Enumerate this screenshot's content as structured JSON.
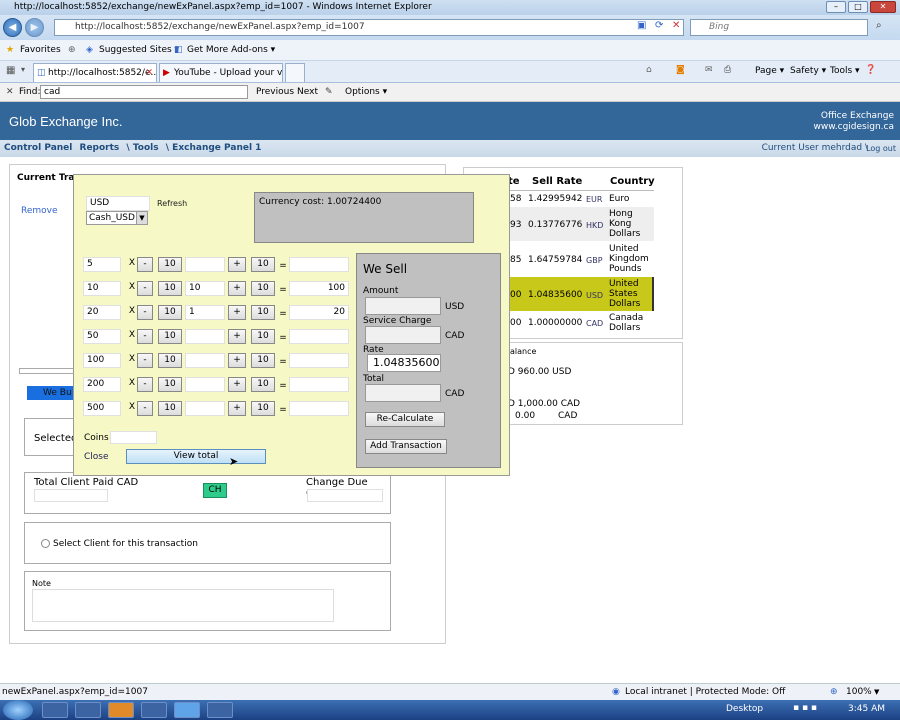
{
  "browser": {
    "window_title": "http://localhost:5852/exchange/newExPanel.aspx?emp_id=1007 - Windows Internet Explorer",
    "address": "http://localhost:5852/exchange/newExPanel.aspx?emp_id=1007",
    "search_placeholder": "Bing",
    "favorites": "Favorites",
    "suggested_sites": "Suggested Sites ▾",
    "addons": "Get More Add-ons ▾",
    "tabs": [
      "http://localhost:5852/e...",
      "YouTube - Upload your vi..."
    ],
    "page_menu": "Page ▾",
    "safety_menu": "Safety ▾",
    "tools_menu": "Tools ▾",
    "find_label": "Find:",
    "find_value": "cad",
    "previous": "Previous",
    "next": "Next",
    "options": "Options ▾"
  },
  "header": {
    "title": "Glob Exchange Inc.",
    "office": "Office Exchange",
    "site": "www.cgidesign.ca"
  },
  "menu": {
    "items": [
      "Control Panel",
      "Reports",
      "\\ Tools",
      "\\ Exchange Panel 1"
    ],
    "current_user": "Current User mehrdad \\",
    "logout": "Log out"
  },
  "left_panel": {
    "current_trans": "Current Tran",
    "remove": "Remove",
    "we_buy": "We Bu",
    "selected": "Selected",
    "total_client_paid": "Total Client Paid CAD",
    "ch": "CH",
    "change_due": "Change Due CAD",
    "select_client": "Select Client for this transaction",
    "note": "Note"
  },
  "rates": {
    "headers": [
      "te",
      "Sell Rate",
      "Country"
    ],
    "rows": [
      {
        "buy": "58",
        "sell": "1.42995942",
        "code": "EUR",
        "country": "Euro"
      },
      {
        "buy": "93",
        "sell": "0.13776776",
        "code": "HKD",
        "country": "Hong Kong Dollars"
      },
      {
        "buy": "85",
        "sell": "1.64759784",
        "code": "GBP",
        "country": "United Kingdom Pounds"
      },
      {
        "buy": "00",
        "sell": "1.04835600",
        "code": "USD",
        "country": "United States Dollars"
      },
      {
        "buy": "00",
        "sell": "1.00000000",
        "code": "CAD",
        "country": "Canada Dollars"
      }
    ],
    "balance_label": "alance",
    "balance_usd": "D 960.00 USD",
    "balance_cad1": "D 1,000.00 CAD",
    "balance_cad2_amount": "0.00",
    "balance_cad2_unit": "CAD"
  },
  "modal": {
    "currency": "USD",
    "refresh": "Refresh",
    "account": "Cash_USD",
    "currency_cost": "Currency cost: 1.00724400",
    "denominations": [
      {
        "face": "5",
        "qty": "",
        "total": ""
      },
      {
        "face": "10",
        "qty": "10",
        "total": "100"
      },
      {
        "face": "20",
        "qty": "1",
        "total": "20"
      },
      {
        "face": "50",
        "qty": "",
        "total": ""
      },
      {
        "face": "100",
        "qty": "",
        "total": ""
      },
      {
        "face": "200",
        "qty": "",
        "total": ""
      },
      {
        "face": "500",
        "qty": "",
        "total": ""
      }
    ],
    "x": "X",
    "minus": "-",
    "plus": "+",
    "ten": "10",
    "eq": "=",
    "coins": "Coins",
    "close": "Close",
    "view_total": "View total",
    "we_sell": "We Sell",
    "amount": "Amount",
    "usd": "USD",
    "service_charge": "Service Charge",
    "cad": "CAD",
    "rate": "Rate",
    "rate_value": "1.04835600",
    "total": "Total",
    "recalculate": "Re-Calculate",
    "add_transaction": "Add Transaction"
  },
  "status": {
    "url": "newExPanel.aspx?emp_id=1007",
    "zone": "Local intranet | Protected Mode: Off",
    "zoom": "100%"
  },
  "taskbar": {
    "desktop": "Desktop",
    "time": "3:45 AM"
  }
}
